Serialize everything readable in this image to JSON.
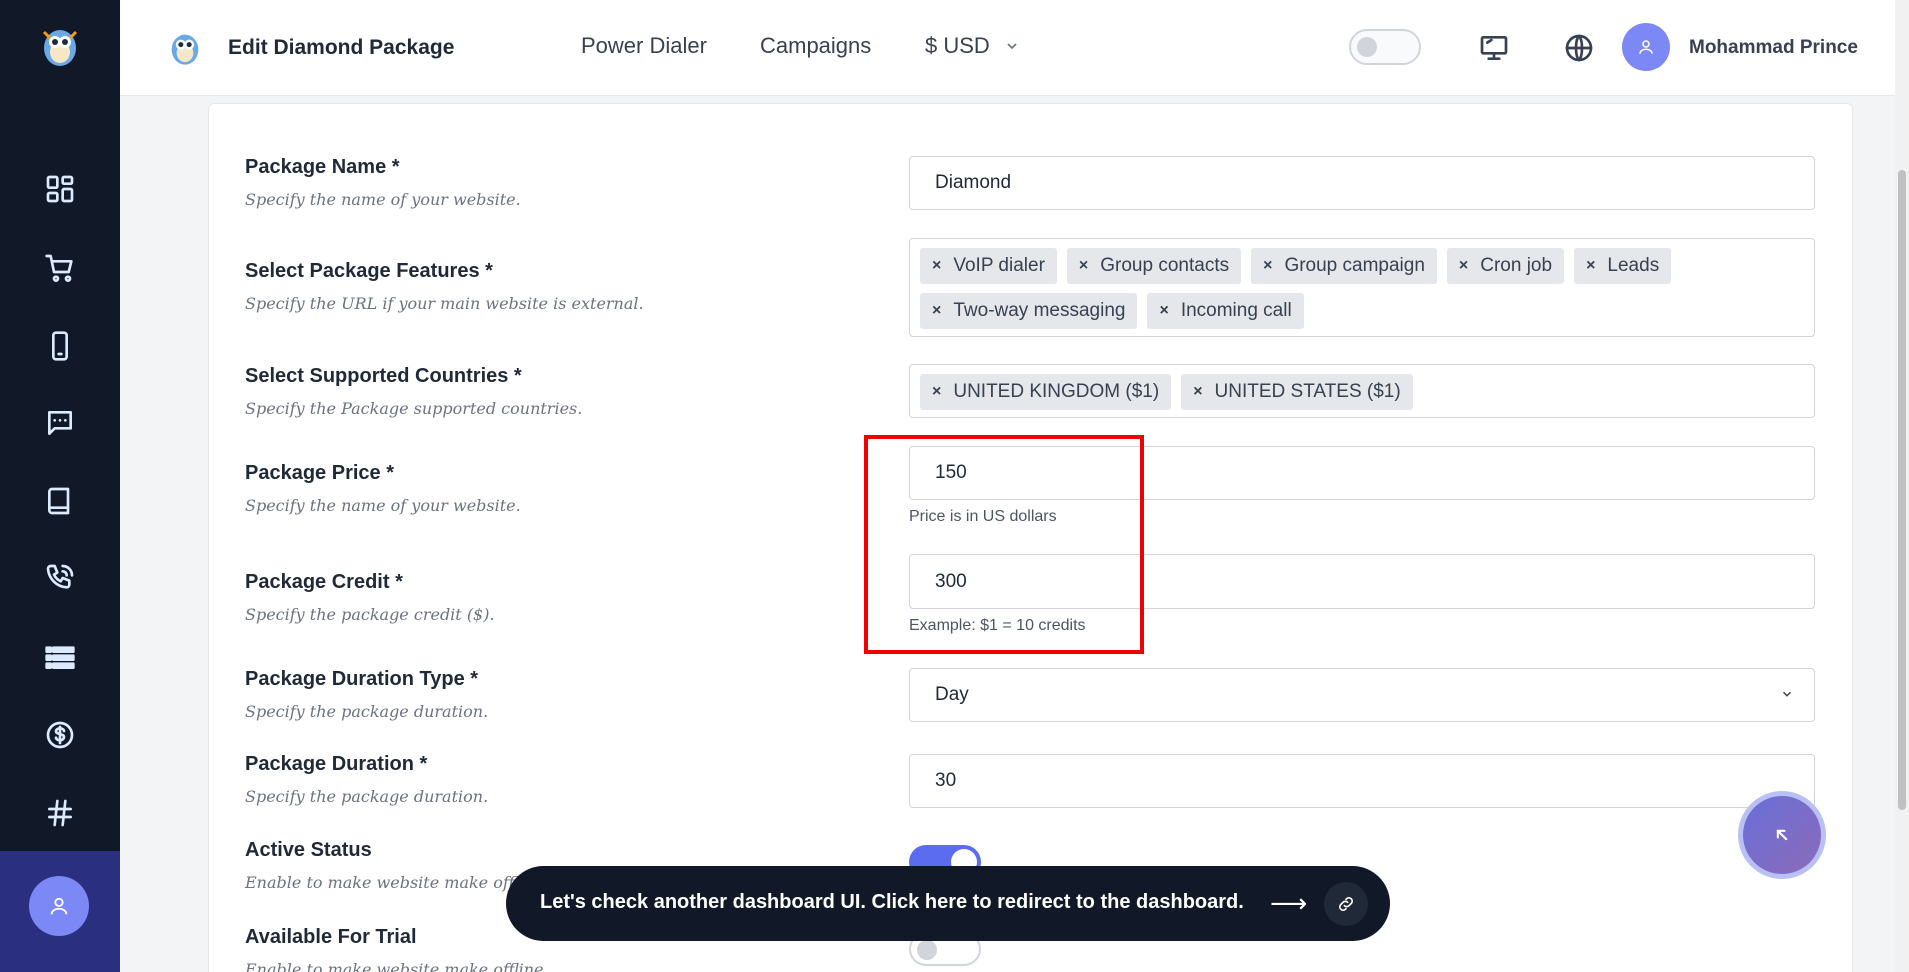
{
  "header": {
    "title": "Edit Diamond Package",
    "nav": [
      "Power Dialer",
      "Campaigns"
    ],
    "currency": "$ USD",
    "user_name": "Mohammad Prince"
  },
  "form": {
    "package_name": {
      "label": "Package Name *",
      "desc": "Specify the name of your website.",
      "value": "Diamond"
    },
    "features": {
      "label": "Select Package Features *",
      "desc": "Specify the URL if your main website is external.",
      "tags": [
        "VoIP dialer",
        "Group contacts",
        "Group campaign",
        "Cron job",
        "Leads",
        "Two-way messaging",
        "Incoming call"
      ]
    },
    "countries": {
      "label": "Select Supported Countries *",
      "desc": "Specify the Package supported countries.",
      "tags": [
        "UNITED KINGDOM ($1)",
        "UNITED STATES ($1)"
      ]
    },
    "price": {
      "label": "Package Price *",
      "desc": "Specify the name of your website.",
      "value": "150",
      "help": "Price is in US dollars"
    },
    "credit": {
      "label": "Package Credit *",
      "desc": "Specify the package credit ($).",
      "value": "300",
      "help": "Example: $1 = 10 credits"
    },
    "duration_type": {
      "label": "Package Duration Type *",
      "desc": "Specify the package duration.",
      "value": "Day"
    },
    "duration": {
      "label": "Package Duration *",
      "desc": "Specify the package duration.",
      "value": "30"
    },
    "active_status": {
      "label": "Active Status",
      "desc": "Enable to make website make offline."
    },
    "trial": {
      "label": "Available For Trial",
      "desc": "Enable to make website make offline."
    }
  },
  "banner": {
    "message": "Let's check another dashboard UI. Click here to redirect to the dashboard.",
    "arrow": "⟶"
  },
  "colors": {
    "sidebar": "#111827",
    "accent": "#5b6cf0",
    "highlight": "#ef0000"
  }
}
